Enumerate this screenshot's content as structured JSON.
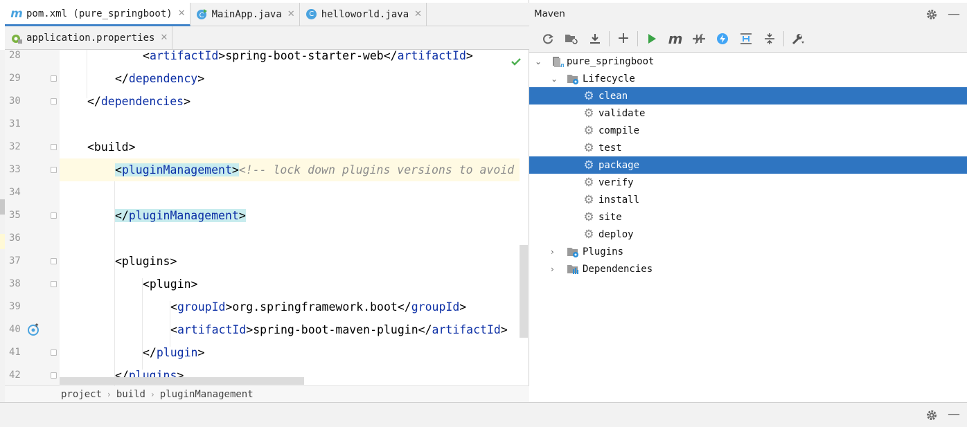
{
  "editor": {
    "tabs_row1": [
      {
        "label": "pom.xml (pure_springboot)",
        "icon": "maven-m-icon",
        "active": true
      },
      {
        "label": "MainApp.java",
        "icon": "java-class-run-icon",
        "active": false
      },
      {
        "label": "helloworld.java",
        "icon": "java-class-icon",
        "active": false
      }
    ],
    "tabs_row2": [
      {
        "label": "application.properties",
        "icon": "properties-file-icon",
        "active": false
      }
    ],
    "line_numbers": [
      "28",
      "29",
      "30",
      "31",
      "32",
      "33",
      "34",
      "35",
      "36",
      "37",
      "38",
      "39",
      "40",
      "41",
      "42"
    ],
    "code": {
      "l28": {
        "open_a": "<",
        "tag_a": "artifactId",
        "close_a": ">",
        "text": "spring-boot-starter-web",
        "open_b": "</",
        "tag_b": "artifactId",
        "close_b": ">"
      },
      "l29": {
        "open": "</",
        "tag": "dependency",
        "close": ">"
      },
      "l30": {
        "open": "</",
        "tag": "dependencies",
        "close": ">"
      },
      "l32": {
        "text": "<build>"
      },
      "l33": {
        "open": "<",
        "tag": "pluginManagement",
        "close": ">",
        "comment": "<!-- lock down plugins versions to avoid u"
      },
      "l35": {
        "open": "</",
        "tag": "pluginManagement",
        "close": ">"
      },
      "l37": {
        "text": "<plugins>"
      },
      "l38": {
        "text": "<plugin>"
      },
      "l39": {
        "open_a": "<",
        "tag_a": "groupId",
        "close_a": ">",
        "text": "org.springframework.boot",
        "open_b": "</",
        "tag_b": "groupId",
        "close_b": ">"
      },
      "l40": {
        "open_a": "<",
        "tag_a": "artifactId",
        "close_a": ">",
        "text": "spring-boot-maven-plugin",
        "open_b": "</",
        "tag_b": "artifactId",
        "close_b": ">"
      },
      "l41": {
        "open": "</",
        "tag": "plugin",
        "close": ">"
      },
      "l42": {
        "open": "</",
        "tag": "plugins",
        "close": ">"
      }
    },
    "breadcrumb": [
      "project",
      "build",
      "pluginManagement"
    ],
    "breadcrumb_sep": "›"
  },
  "maven": {
    "title": "Maven",
    "toolbar_icons": [
      "reload-icon",
      "add-folder-icon",
      "download-icon",
      "add-icon",
      "run-icon",
      "maven-m-icon",
      "toggle-offline-icon",
      "skip-tests-icon",
      "show-dependencies-icon",
      "collapse-all-icon",
      "settings-wrench-icon"
    ],
    "tree": {
      "project": "pure_springboot",
      "lifecycle": "Lifecycle",
      "phases": [
        "clean",
        "validate",
        "compile",
        "test",
        "package",
        "verify",
        "install",
        "site",
        "deploy"
      ],
      "selected_phases": [
        "clean",
        "package"
      ],
      "plugins": "Plugins",
      "dependencies": "Dependencies"
    }
  },
  "colors": {
    "selection": "#2f75c1",
    "tag_name": "#0d30a6",
    "highlight": "#c8ecee",
    "comment": "#8c8c8c"
  }
}
